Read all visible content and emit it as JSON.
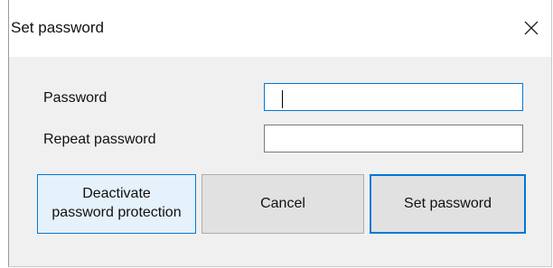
{
  "dialog": {
    "title": "Set password",
    "close_icon": "close-icon"
  },
  "form": {
    "password_label": "Password",
    "password_value": "",
    "repeat_label": "Repeat password",
    "repeat_value": ""
  },
  "buttons": {
    "deactivate_line1": "Deactivate",
    "deactivate_line2": "password protection",
    "cancel": "Cancel",
    "set_password": "Set password"
  },
  "colors": {
    "accent": "#0078d7",
    "hover_bg": "#e5f1fb",
    "dialog_bg": "#f0f0f0"
  }
}
